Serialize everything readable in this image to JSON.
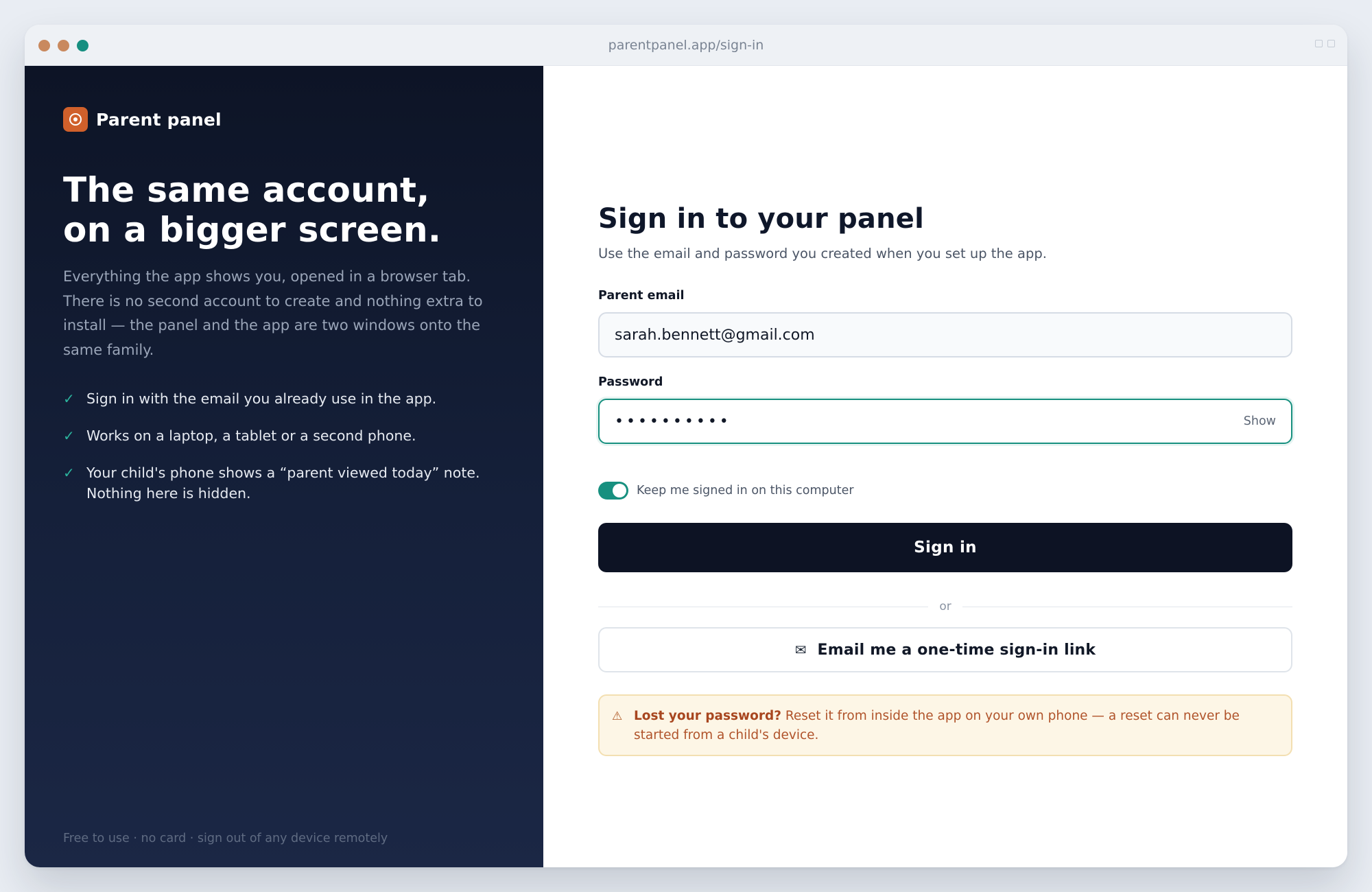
{
  "browser": {
    "url": "parentpanel.app/sign-in"
  },
  "brand": {
    "name": "Parent panel",
    "accent": "#d0602b"
  },
  "hero": {
    "title_line1": "The same account,",
    "title_line2": "on a bigger screen.",
    "description": "Everything the app shows you, opened in a browser tab. There is no second account to create and nothing extra to install — the panel and the app are two windows onto the same family."
  },
  "features": [
    {
      "icon": "check-icon",
      "text": "Sign in with the email you already use in the app."
    },
    {
      "icon": "check-icon",
      "text": "Works on a laptop, a tablet or a second phone."
    },
    {
      "icon": "check-icon",
      "text": "Your child's phone shows a “parent viewed today” note. Nothing here is hidden."
    }
  ],
  "left_footer": "Free to use · no card · sign out of any device remotely",
  "form": {
    "title": "Sign in to your panel",
    "subtitle": "Use the email and password you created when you set up the app.",
    "email_label": "Parent email",
    "email_value": "sarah.bennett@gmail.com",
    "password_label": "Password",
    "password_masked": "••••••••••",
    "show_label": "Show",
    "keep_signed_in_label": "Keep me signed in on this computer",
    "keep_signed_in": true,
    "sign_in_label": "Sign in",
    "or_label": "or",
    "magic_link_label": "Email me a one-time sign-in link",
    "magic_link_icon": "mail-icon",
    "notice_bold": "Lost your password?",
    "notice_text": "Reset it from inside the app on your own phone — a reset can never be started from a child's device.",
    "notice_icon": "warning-icon"
  },
  "colors": {
    "primary_button": "#0d1324",
    "focus_teal": "#17907f",
    "panel_dark": "#0d1426",
    "notice_bg": "#fdf6e6"
  }
}
